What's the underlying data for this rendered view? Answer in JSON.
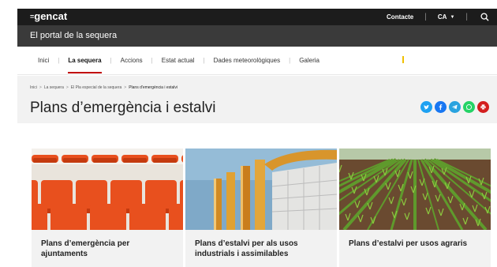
{
  "topbar": {
    "logo_mark": "=",
    "logo_text": "gencat",
    "contact": "Contacte",
    "language": "CA"
  },
  "portal": {
    "title": "El portal de la sequera"
  },
  "nav": {
    "items": [
      {
        "label": "Inici"
      },
      {
        "label": "La sequera"
      },
      {
        "label": "Accions"
      },
      {
        "label": "Estat actual"
      },
      {
        "label": "Dades meteorològiques"
      },
      {
        "label": "Galeria"
      }
    ],
    "active": "La sequera"
  },
  "breadcrumb": {
    "items": [
      "Inici",
      "La sequera",
      "El Pla especial de la sequera"
    ],
    "current": "Plans d'emergència i estalvi"
  },
  "page": {
    "title": "Plans d’emergència i estalvi"
  },
  "share": {
    "buttons": [
      {
        "icon": "twitter-icon",
        "color": "#1da1f2"
      },
      {
        "icon": "facebook-icon",
        "color": "#1877f2"
      },
      {
        "icon": "telegram-icon",
        "color": "#2aa3df"
      },
      {
        "icon": "whatsapp-icon",
        "color": "#25d366"
      },
      {
        "icon": "print-icon",
        "color": "#d31f1f"
      }
    ]
  },
  "cards": [
    {
      "title": "Plans d’emergència per ajuntaments",
      "image": "orange-chairs"
    },
    {
      "title": "Plans d’estalvi per als usos industrials i assimilables",
      "image": "industrial-pipes"
    },
    {
      "title": "Plans d’estalvi per usos agraris",
      "image": "crop-field"
    }
  ]
}
